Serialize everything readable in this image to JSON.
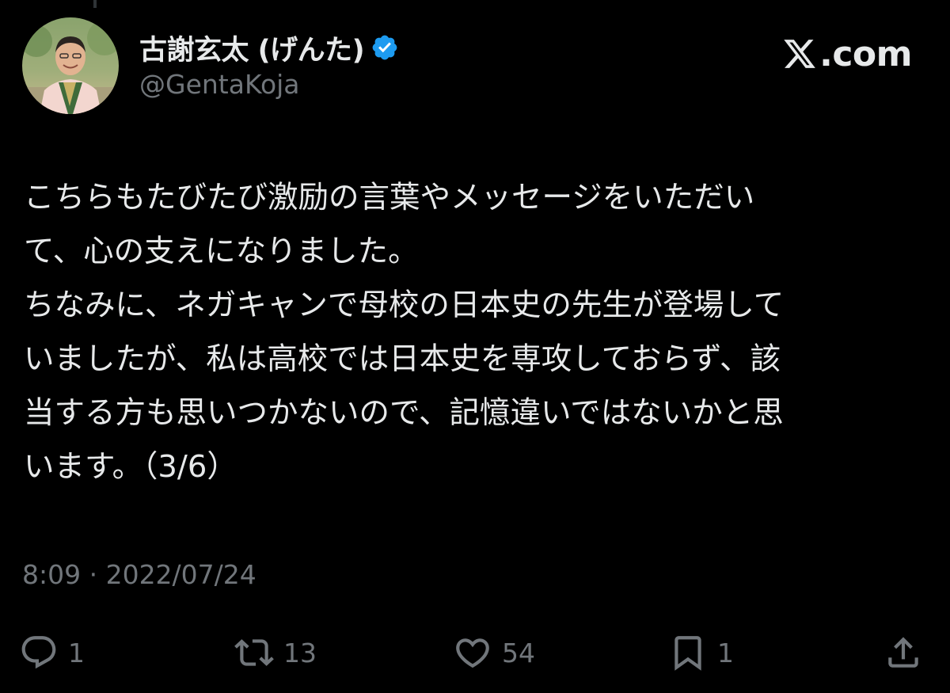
{
  "brand": {
    "label": ".com"
  },
  "author": {
    "display_name": "古謝玄太 (げんた)",
    "handle": "@GentaKoja",
    "verified": true
  },
  "tweet": {
    "lines": [
      "こちらもたびたび激励の言葉やメッセージをいただい",
      "て、心の支えになりました。",
      "ちなみに、ネガキャンで母校の日本史の先生が登場して",
      "いましたが、私は高校では日本史を専攻しておらず、該",
      "当する方も思いつかないので、記憶違いではないかと思",
      "います。（3/6）"
    ],
    "timestamp": "8:09 · 2022/07/24"
  },
  "actions": {
    "replies": "1",
    "reposts": "13",
    "likes": "54",
    "bookmarks": "1"
  },
  "colors": {
    "background": "#000000",
    "primary_text": "#e7e9ea",
    "secondary_text": "#71767b",
    "verified_blue": "#1d9bf0"
  },
  "icons": {
    "reply": "reply-icon",
    "repost": "repost-icon",
    "like": "heart-icon",
    "bookmark": "bookmark-icon",
    "share": "share-icon",
    "verified": "verified-badge-icon",
    "brand": "x-logo-icon"
  }
}
